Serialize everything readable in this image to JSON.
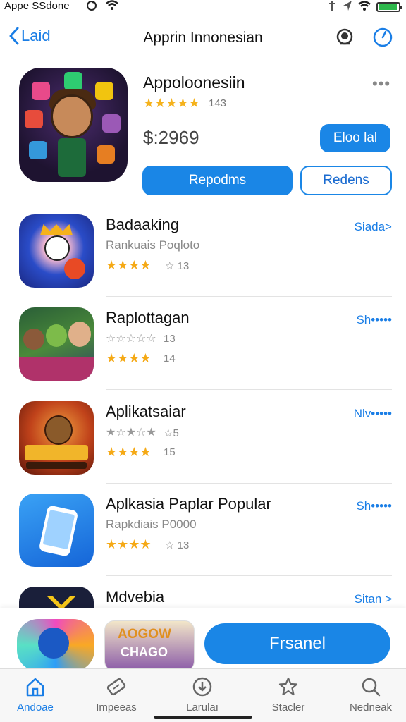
{
  "status_bar": {
    "carrier": "Appe SSdone",
    "battery_color": "#2db84b"
  },
  "nav": {
    "back_label": "Laid",
    "title": "Apprin Innonesian",
    "icons": [
      "globe-icon",
      "clock-icon"
    ]
  },
  "hero": {
    "title": "Appoloonesiin",
    "stars": "★★★★★",
    "rating_count": "143",
    "more_label": "•••",
    "price": "$:2969",
    "buy_label": "Eloo lal",
    "primary_label": "Repodms",
    "secondary_label": "Redens"
  },
  "apps": [
    {
      "name": "Badaaking",
      "subtitle": "Rankuais Poqloto",
      "stars": "★★★★",
      "count": "☆ 13",
      "action": "Siada>"
    },
    {
      "name": "Raplottagan",
      "outline_stars": "☆☆☆☆☆",
      "outline_count": "13",
      "stars": "★★★★",
      "count": "14",
      "action": "Sh•••••"
    },
    {
      "name": "Aplikatsaiar",
      "outline_stars": "★☆★☆★",
      "outline_count": "☆5",
      "stars": "★★★★",
      "count": "15",
      "action": "Nlv•••••"
    },
    {
      "name": "Aplkasia Paplar Popular",
      "subtitle": "Rapkdiais P0000",
      "stars": "★★★★",
      "count": "☆ 13",
      "action": "Sh•••••"
    },
    {
      "name": "Mdvebia",
      "action": "Sitan >"
    }
  ],
  "promo": {
    "art_title": "AOGOW",
    "art_sub": "CHAGO",
    "button_label": "Frsanel"
  },
  "tabs": [
    {
      "label": "Andoae",
      "icon": "home-icon",
      "active": true
    },
    {
      "label": "Impeeas",
      "icon": "ticket-icon",
      "active": false
    },
    {
      "label": "Larulaı",
      "icon": "download-icon",
      "active": false
    },
    {
      "label": "Stacler",
      "icon": "star-icon",
      "active": false
    },
    {
      "label": "Nedneak",
      "icon": "search-icon",
      "active": false
    }
  ],
  "accent_color": "#1a86e6"
}
